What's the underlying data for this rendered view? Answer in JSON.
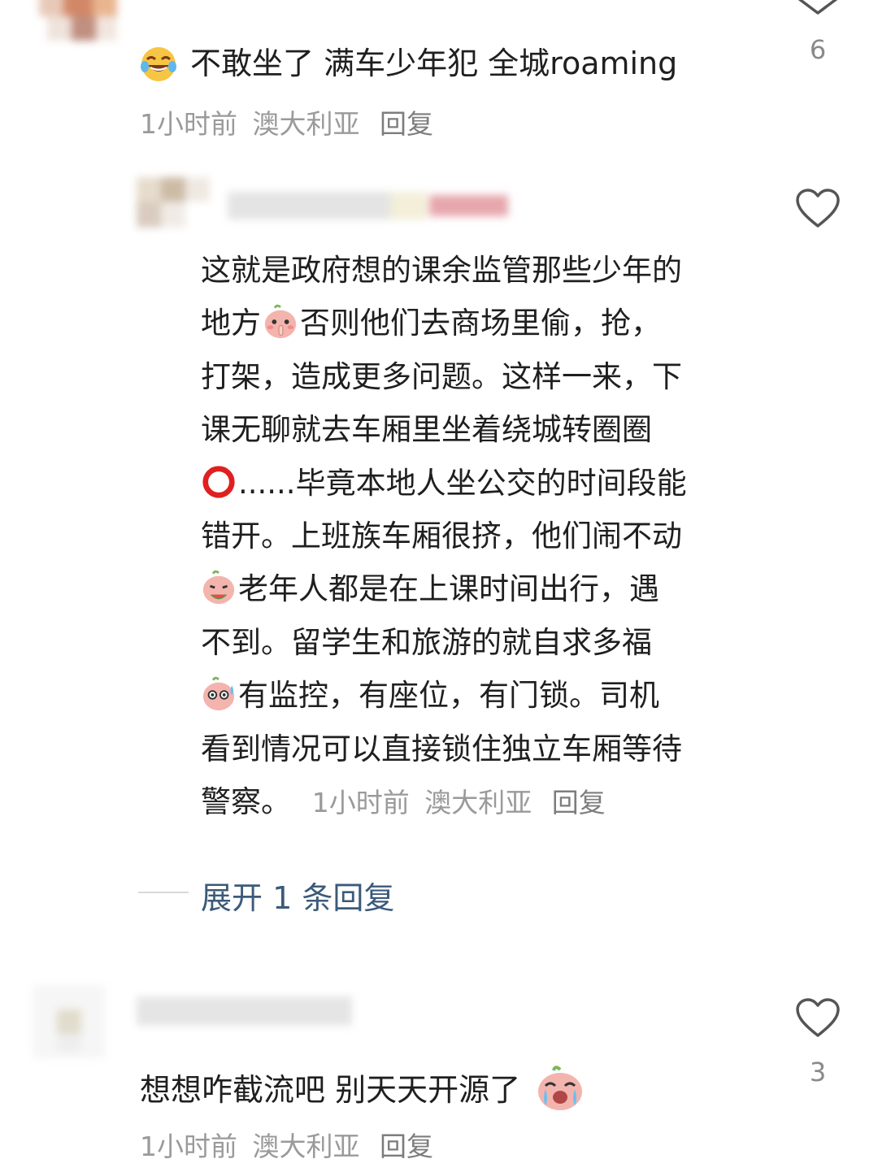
{
  "comments": [
    {
      "text": "不敢坐了 满车少年犯 全城roaming",
      "emoji_icon": "joy-tears-emoji",
      "time": "1小时前",
      "location": "澳大利亚",
      "reply_label": "回复",
      "likes": "6"
    },
    {
      "lines": [
        "这就是政府想的课余监管那些少年的",
        "地方",
        "否则他们去商场里偷，抢，",
        "打架，造成更多问题。这样一来，下",
        "课无聊就去车厢里坐着绕城转圈圈",
        "......毕竟本地人坐公交的时间段能",
        "错开。上班族车厢很挤，他们闹不动",
        "老年人都是在上课时间出行，遇",
        "不到。留学生和旅游的就自求多福",
        "有监控，有座位，有门锁。司机",
        "看到情况可以直接锁住独立车厢等待",
        "警察。"
      ],
      "time": "1小时前",
      "location": "澳大利亚",
      "reply_label": "回复",
      "expand_label": "展开 1 条回复"
    },
    {
      "text": "想想咋截流吧 别天天开源了",
      "emoji_icon": "crying-peach-emoji",
      "time": "1小时前",
      "location": "澳大利亚",
      "reply_label": "回复",
      "likes": "3"
    }
  ],
  "colors": {
    "text": "#1f1f1f",
    "meta": "#9a9a9a",
    "link": "#3c5a7a",
    "icon": "#555555"
  }
}
